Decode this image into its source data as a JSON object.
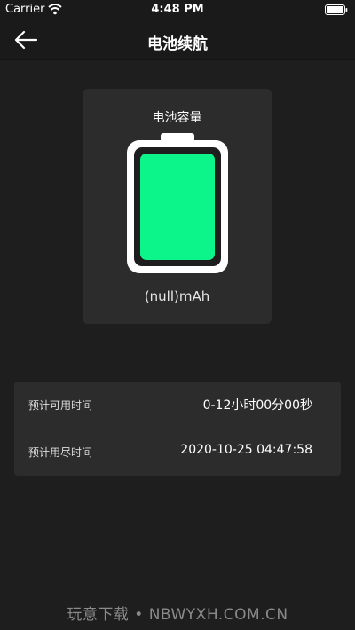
{
  "status_bar": {
    "carrier": "Carrier",
    "time": "4:48 PM"
  },
  "nav": {
    "title": "电池续航",
    "back_icon": "arrow-left-icon"
  },
  "battery_card": {
    "label": "电池容量",
    "value": "(null)mAh",
    "fill_color": "#0cf58b"
  },
  "info": {
    "rows": [
      {
        "label": "预计可用时间",
        "value": "0-12小时00分00秒"
      },
      {
        "label": "预计用尽时间",
        "value": "2020-10-25 04:47:58"
      }
    ]
  },
  "watermark": "玩意下载 • NBWYXH.COM.CN"
}
